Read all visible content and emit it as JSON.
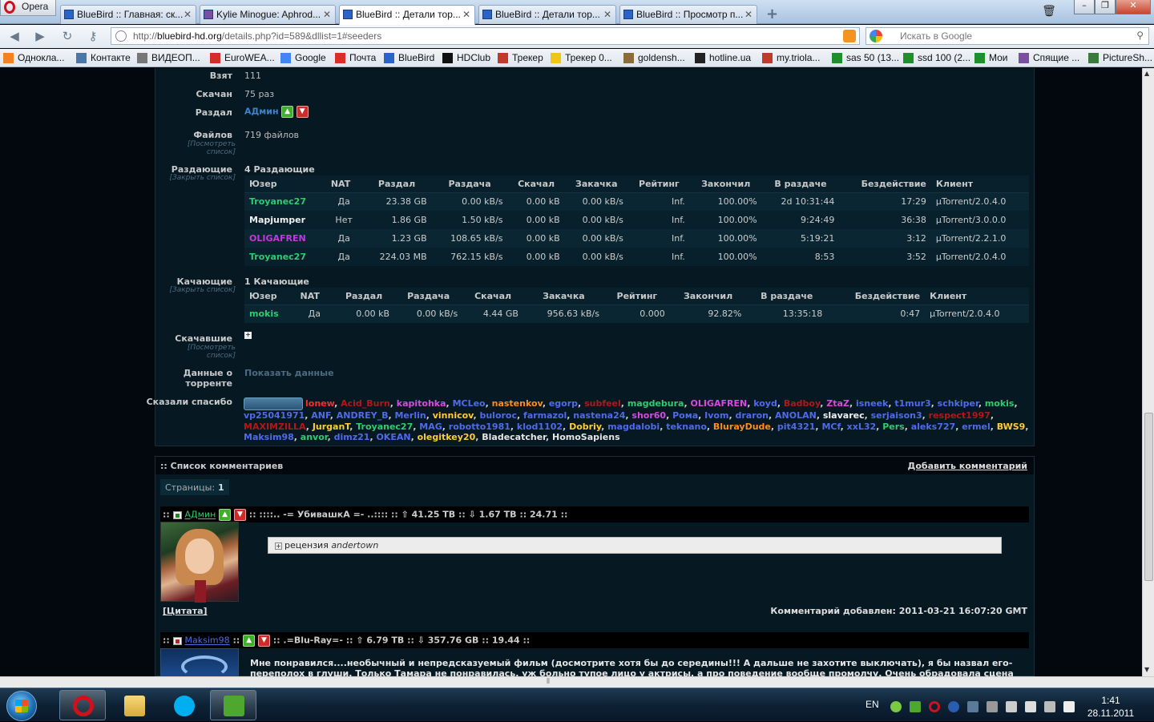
{
  "browser": {
    "menu_label": "Opera",
    "tabs": [
      {
        "label": "BlueBird :: Главная: ск..."
      },
      {
        "label": "Kylie Minogue: Aphrod..."
      },
      {
        "label": "BlueBird :: Детали тор..."
      },
      {
        "label": "BlueBird :: Детали тор..."
      },
      {
        "label": "BlueBird :: Просмотр п..."
      }
    ],
    "url_prefix": "http://",
    "url_host": "bluebird-hd.org",
    "url_path": "/details.php?id=589&dllist=1#seeders",
    "search_placeholder": "Искать в Google",
    "bookmarks": [
      {
        "label": "Однокла...",
        "color": "#f58220"
      },
      {
        "label": "Контакте",
        "color": "#4a76a8"
      },
      {
        "label": "ВИДЕОП...",
        "color": "#777777"
      },
      {
        "label": "EuroWEA...",
        "color": "#d62b2b"
      },
      {
        "label": "Google",
        "color": "#4285f4"
      },
      {
        "label": "Почта",
        "color": "#d93025"
      },
      {
        "label": "BlueBird",
        "color": "#2a64c8"
      },
      {
        "label": "HDClub",
        "color": "#111111"
      },
      {
        "label": "Трекер",
        "color": "#c0392b"
      },
      {
        "label": "Трекер 0...",
        "color": "#f0c419"
      },
      {
        "label": "goldensh...",
        "color": "#8a6d3b"
      },
      {
        "label": "hotline.ua",
        "color": "#222222"
      },
      {
        "label": "my.triola...",
        "color": "#c0392b"
      },
      {
        "label": "sas 50 (13...",
        "color": "#1f8f2c"
      },
      {
        "label": "ssd 100 (2...",
        "color": "#1f8f2c"
      },
      {
        "label": "Мои",
        "color": "#1f8f2c"
      },
      {
        "label": "Спящие ...",
        "color": "#7a4ea0"
      },
      {
        "label": "PictureSh...",
        "color": "#3a7a3a"
      }
    ]
  },
  "details": {
    "taken_label": "Взят",
    "taken_value": "111",
    "downloaded_label": "Скачан",
    "downloaded_value": "75 раз",
    "uploader_label": "Раздал",
    "uploader_value": "АДмин",
    "files_label": "Файлов",
    "files_sub": "[Посмотреть список]",
    "files_value": "719 файлов",
    "seeders_label": "Раздающие",
    "seeders_sub": "[Закрыть список]",
    "seeders_count": "4 Раздающие",
    "leechers_label": "Качающие",
    "leechers_sub": "[Закрыть список]",
    "leechers_count": "1 Качающие",
    "completed_label": "Скачавшие",
    "completed_sub": "[Посмотреть список]",
    "torrent_data_label": "Данные о торренте",
    "torrent_data_link": "Показать данные",
    "thanks_label": "Сказали спасибо"
  },
  "peer_columns_seeders": [
    "Юзер",
    "NAT",
    "Раздал",
    "Раздача",
    "Скачал",
    "Закачка",
    "Рейтинг",
    "Закончил",
    "В раздаче",
    "Бездействие",
    "Клиент"
  ],
  "seeders": [
    {
      "user": "Troyanec27",
      "color": "#2ecc71",
      "nat": "Да",
      "uploaded": "23.38 GB",
      "up_speed": "0.00 kB/s",
      "downloaded": "0.00 kB",
      "down_speed": "0.00 kB/s",
      "ratio": "Inf.",
      "done": "100.00%",
      "seeding": "2d 10:31:44",
      "idle": "17:29",
      "client": "µTorrent/2.0.4.0"
    },
    {
      "user": "Mapjumper",
      "color": "#f0f0f0",
      "nat": "Нет",
      "uploaded": "1.86 GB",
      "up_speed": "1.50 kB/s",
      "downloaded": "0.00 kB",
      "down_speed": "0.00 kB/s",
      "ratio": "Inf.",
      "done": "100.00%",
      "seeding": "9:24:49",
      "idle": "36:38",
      "client": "µTorrent/3.0.0.0"
    },
    {
      "user": "OLIGAFREN",
      "color": "#c23ad9",
      "nat": "Да",
      "uploaded": "1.23 GB",
      "up_speed": "108.65 kB/s",
      "downloaded": "0.00 kB",
      "down_speed": "0.00 kB/s",
      "ratio": "Inf.",
      "done": "100.00%",
      "seeding": "5:19:21",
      "idle": "3:12",
      "client": "µTorrent/2.2.1.0"
    },
    {
      "user": "Troyanec27",
      "color": "#2ecc71",
      "nat": "Да",
      "uploaded": "224.03 MB",
      "up_speed": "762.15 kB/s",
      "downloaded": "0.00 kB",
      "down_speed": "0.00 kB/s",
      "ratio": "Inf.",
      "done": "100.00%",
      "seeding": "8:53",
      "idle": "3:52",
      "client": "µTorrent/2.0.4.0"
    }
  ],
  "peer_columns_leechers": [
    "Юзер",
    "NAT",
    "Раздал",
    "Раздача",
    "Скачал",
    "Закачка",
    "Рейтинг",
    "Закончил",
    "В раздаче",
    "Бездействие",
    "Клиент"
  ],
  "leechers": [
    {
      "user": "mokis",
      "color": "#2ecc71",
      "nat": "Да",
      "uploaded": "0.00 kB",
      "up_speed": "0.00 kB/s",
      "downloaded": "4.44 GB",
      "down_speed": "956.63 kB/s",
      "ratio": "0.000",
      "done": "92.82%",
      "seeding": "13:35:18",
      "idle": "0:47",
      "client": "µTorrent/2.0.4.0"
    }
  ],
  "thanks_users": [
    {
      "n": "lonew",
      "c": "#ff2a2a"
    },
    {
      "n": "Acid_Burn",
      "c": "#b01818"
    },
    {
      "n": "kapitohka",
      "c": "#d54ae0"
    },
    {
      "n": "MCLeo",
      "c": "#4f6be8"
    },
    {
      "n": "nastenkov",
      "c": "#ff8c1a"
    },
    {
      "n": "egorp",
      "c": "#4f6be8"
    },
    {
      "n": "subfeel",
      "c": "#b01818"
    },
    {
      "n": "magdebura",
      "c": "#2ecc71"
    },
    {
      "n": "OLIGAFREN",
      "c": "#d54ae0"
    },
    {
      "n": "koyd",
      "c": "#4f6be8"
    },
    {
      "n": "Badboy",
      "c": "#b01818"
    },
    {
      "n": "ZtaZ",
      "c": "#d54ae0"
    },
    {
      "n": "isneek",
      "c": "#4f6be8"
    },
    {
      "n": "t1mur3",
      "c": "#4f6be8"
    },
    {
      "n": "schkiper",
      "c": "#4f6be8"
    },
    {
      "n": "mokis",
      "c": "#2ecc71"
    },
    {
      "n": "vp25041971",
      "c": "#4f6be8"
    },
    {
      "n": "ANF",
      "c": "#4f6be8"
    },
    {
      "n": "ANDREY_B",
      "c": "#4f6be8"
    },
    {
      "n": "Merlin",
      "c": "#4f6be8"
    },
    {
      "n": "vinnicov",
      "c": "#ffcc33"
    },
    {
      "n": "buloroc",
      "c": "#4f6be8"
    },
    {
      "n": "farmazol",
      "c": "#4f6be8"
    },
    {
      "n": "nastena24",
      "c": "#4f6be8"
    },
    {
      "n": "shor60",
      "c": "#d54ae0"
    },
    {
      "n": "Рома",
      "c": "#4f6be8"
    },
    {
      "n": "Ivom",
      "c": "#4f6be8"
    },
    {
      "n": "draron",
      "c": "#4f6be8"
    },
    {
      "n": "ANOLAN",
      "c": "#4f6be8"
    },
    {
      "n": "slavarec",
      "c": "#f0f0f0"
    },
    {
      "n": "serjaison3",
      "c": "#4f6be8"
    },
    {
      "n": "respect1997",
      "c": "#b01818"
    },
    {
      "n": "MAXIMZILLA",
      "c": "#b01818"
    },
    {
      "n": "JurganT",
      "c": "#ffcc33"
    },
    {
      "n": "Troyanec27",
      "c": "#2ecc71"
    },
    {
      "n": "MAG",
      "c": "#4f6be8"
    },
    {
      "n": "robotto1981",
      "c": "#4f6be8"
    },
    {
      "n": "klod1102",
      "c": "#4f6be8"
    },
    {
      "n": "Dobriy",
      "c": "#ffcc33"
    },
    {
      "n": "magdalobi",
      "c": "#4f6be8"
    },
    {
      "n": "teknano",
      "c": "#4f6be8"
    },
    {
      "n": "BlurayDude",
      "c": "#ff8c1a"
    },
    {
      "n": "pit4321",
      "c": "#4f6be8"
    },
    {
      "n": "MCf",
      "c": "#4f6be8"
    },
    {
      "n": "xxL32",
      "c": "#4f6be8"
    },
    {
      "n": "Pers",
      "c": "#2ecc71"
    },
    {
      "n": "aleks727",
      "c": "#4f6be8"
    },
    {
      "n": "ermel",
      "c": "#4f6be8"
    },
    {
      "n": "BWS9",
      "c": "#ffcc33"
    },
    {
      "n": "Maksim98",
      "c": "#4f6be8"
    },
    {
      "n": "anvor",
      "c": "#2ecc71"
    },
    {
      "n": "dimz21",
      "c": "#4f6be8"
    },
    {
      "n": "OKEAN",
      "c": "#4f6be8"
    },
    {
      "n": "olegitkey20",
      "c": "#ffcc33"
    },
    {
      "n": "Bladecatcher",
      "c": "#e6e6e6"
    },
    {
      "n": "HomoSapiens",
      "c": "#e6e6e6"
    }
  ],
  "comments": {
    "header": ":: Список комментариев",
    "add_link": "Добавить комментарий",
    "pages_label": "Страницы:",
    "pages_current": "1",
    "c1": {
      "prefix": "::",
      "author": "АДмин",
      "info": ":: ::::.. -= УбивашкА =- ..:::: :: ⇧ 41.25 TB :: ⇩ 1.67 TB :: 24.71 ::",
      "review_label": "рецензия",
      "review_author": "andertown",
      "quote": "[Цитата]",
      "added": "Комментарий добавлен: 2011-03-21 16:07:20 GMT"
    },
    "c2": {
      "prefix": "::",
      "author": "Maksim98",
      "sep": "::",
      "info": ":: .=Blu-Ray=- :: ⇧ 6.79 TB :: ⇩ 357.76 GB :: 19.44 ::",
      "text": "Мне понравился....необычный и непредсказуемый фильм (досмотрите хотя бы до середины!!! А дальше не захотите выключать), я бы назвал его-переполох в глуши. Только Тамара не понравилась, уж больно тупое лицо у актрисы, а про поведение вообще промолчу. Очень обрадовала сцена с поломанным носом, ух."
    }
  },
  "taskbar": {
    "lang": "EN",
    "time": "1:41",
    "date": "28.11.2011"
  }
}
